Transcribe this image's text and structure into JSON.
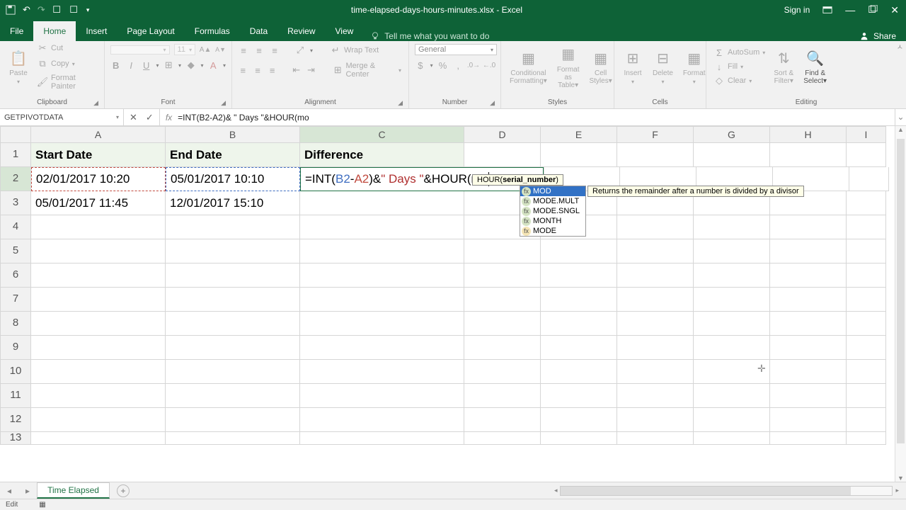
{
  "title": "time-elapsed-days-hours-minutes.xlsx - Excel",
  "signin": "Sign in",
  "tabs": {
    "file": "File",
    "home": "Home",
    "insert": "Insert",
    "pagelayout": "Page Layout",
    "formulas": "Formulas",
    "data": "Data",
    "review": "Review",
    "view": "View"
  },
  "tellme": "Tell me what you want to do",
  "share": "Share",
  "clipboard": {
    "paste": "Paste",
    "cut": "Cut",
    "copy": "Copy",
    "painter": "Format Painter",
    "label": "Clipboard"
  },
  "font": {
    "font_name": "",
    "size": "11",
    "label": "Font"
  },
  "alignment": {
    "wrap": "Wrap Text",
    "merge": "Merge & Center",
    "label": "Alignment"
  },
  "number": {
    "format": "General",
    "label": "Number"
  },
  "styles": {
    "cond": "Conditional Formatting",
    "table": "Format as Table",
    "cell": "Cell Styles",
    "label": "Styles"
  },
  "cells": {
    "insert": "Insert",
    "delete": "Delete",
    "format": "Format",
    "label": "Cells"
  },
  "editing": {
    "autosum": "AutoSum",
    "fill": "Fill",
    "clear": "Clear",
    "sort": "Sort & Filter",
    "find": "Find & Select",
    "label": "Editing"
  },
  "namebox": "GETPIVOTDATA",
  "formula": "=INT(B2-A2)& \" Days \"&HOUR(mo",
  "colA": "A",
  "colB": "B",
  "colC": "C",
  "colD": "D",
  "colE": "E",
  "colF": "F",
  "colG": "G",
  "colH": "H",
  "colI": "I",
  "rows": [
    "1",
    "2",
    "3",
    "4",
    "5",
    "6",
    "7",
    "8",
    "9",
    "10",
    "11",
    "12",
    "13"
  ],
  "headers": {
    "a": "Start Date",
    "b": "End Date",
    "c": "Difference"
  },
  "data_rows": {
    "r2a": "02/01/2017 10:20",
    "r2b": "05/01/2017 10:10",
    "r3a": "05/01/2017 11:45",
    "r3b": "12/01/2017 15:10"
  },
  "cell_edit": {
    "pre": "=INT(",
    "ref1": "B2",
    "mid1": "-",
    "ref2": "A2",
    "mid2": ")& ",
    "lit": "\" Days \"",
    "mid3": "&HOUR(mo"
  },
  "tooltip": {
    "fn": "HOUR(",
    "arg": "serial_number",
    "end": ")"
  },
  "ac": {
    "mod": "MOD",
    "modemult": "MODE.MULT",
    "modesngl": "MODE.SNGL",
    "month": "MONTH",
    "mode": "MODE"
  },
  "ac_desc": "Returns the remainder after a number is divided by a divisor",
  "sheet": "Time Elapsed",
  "status": "Edit"
}
